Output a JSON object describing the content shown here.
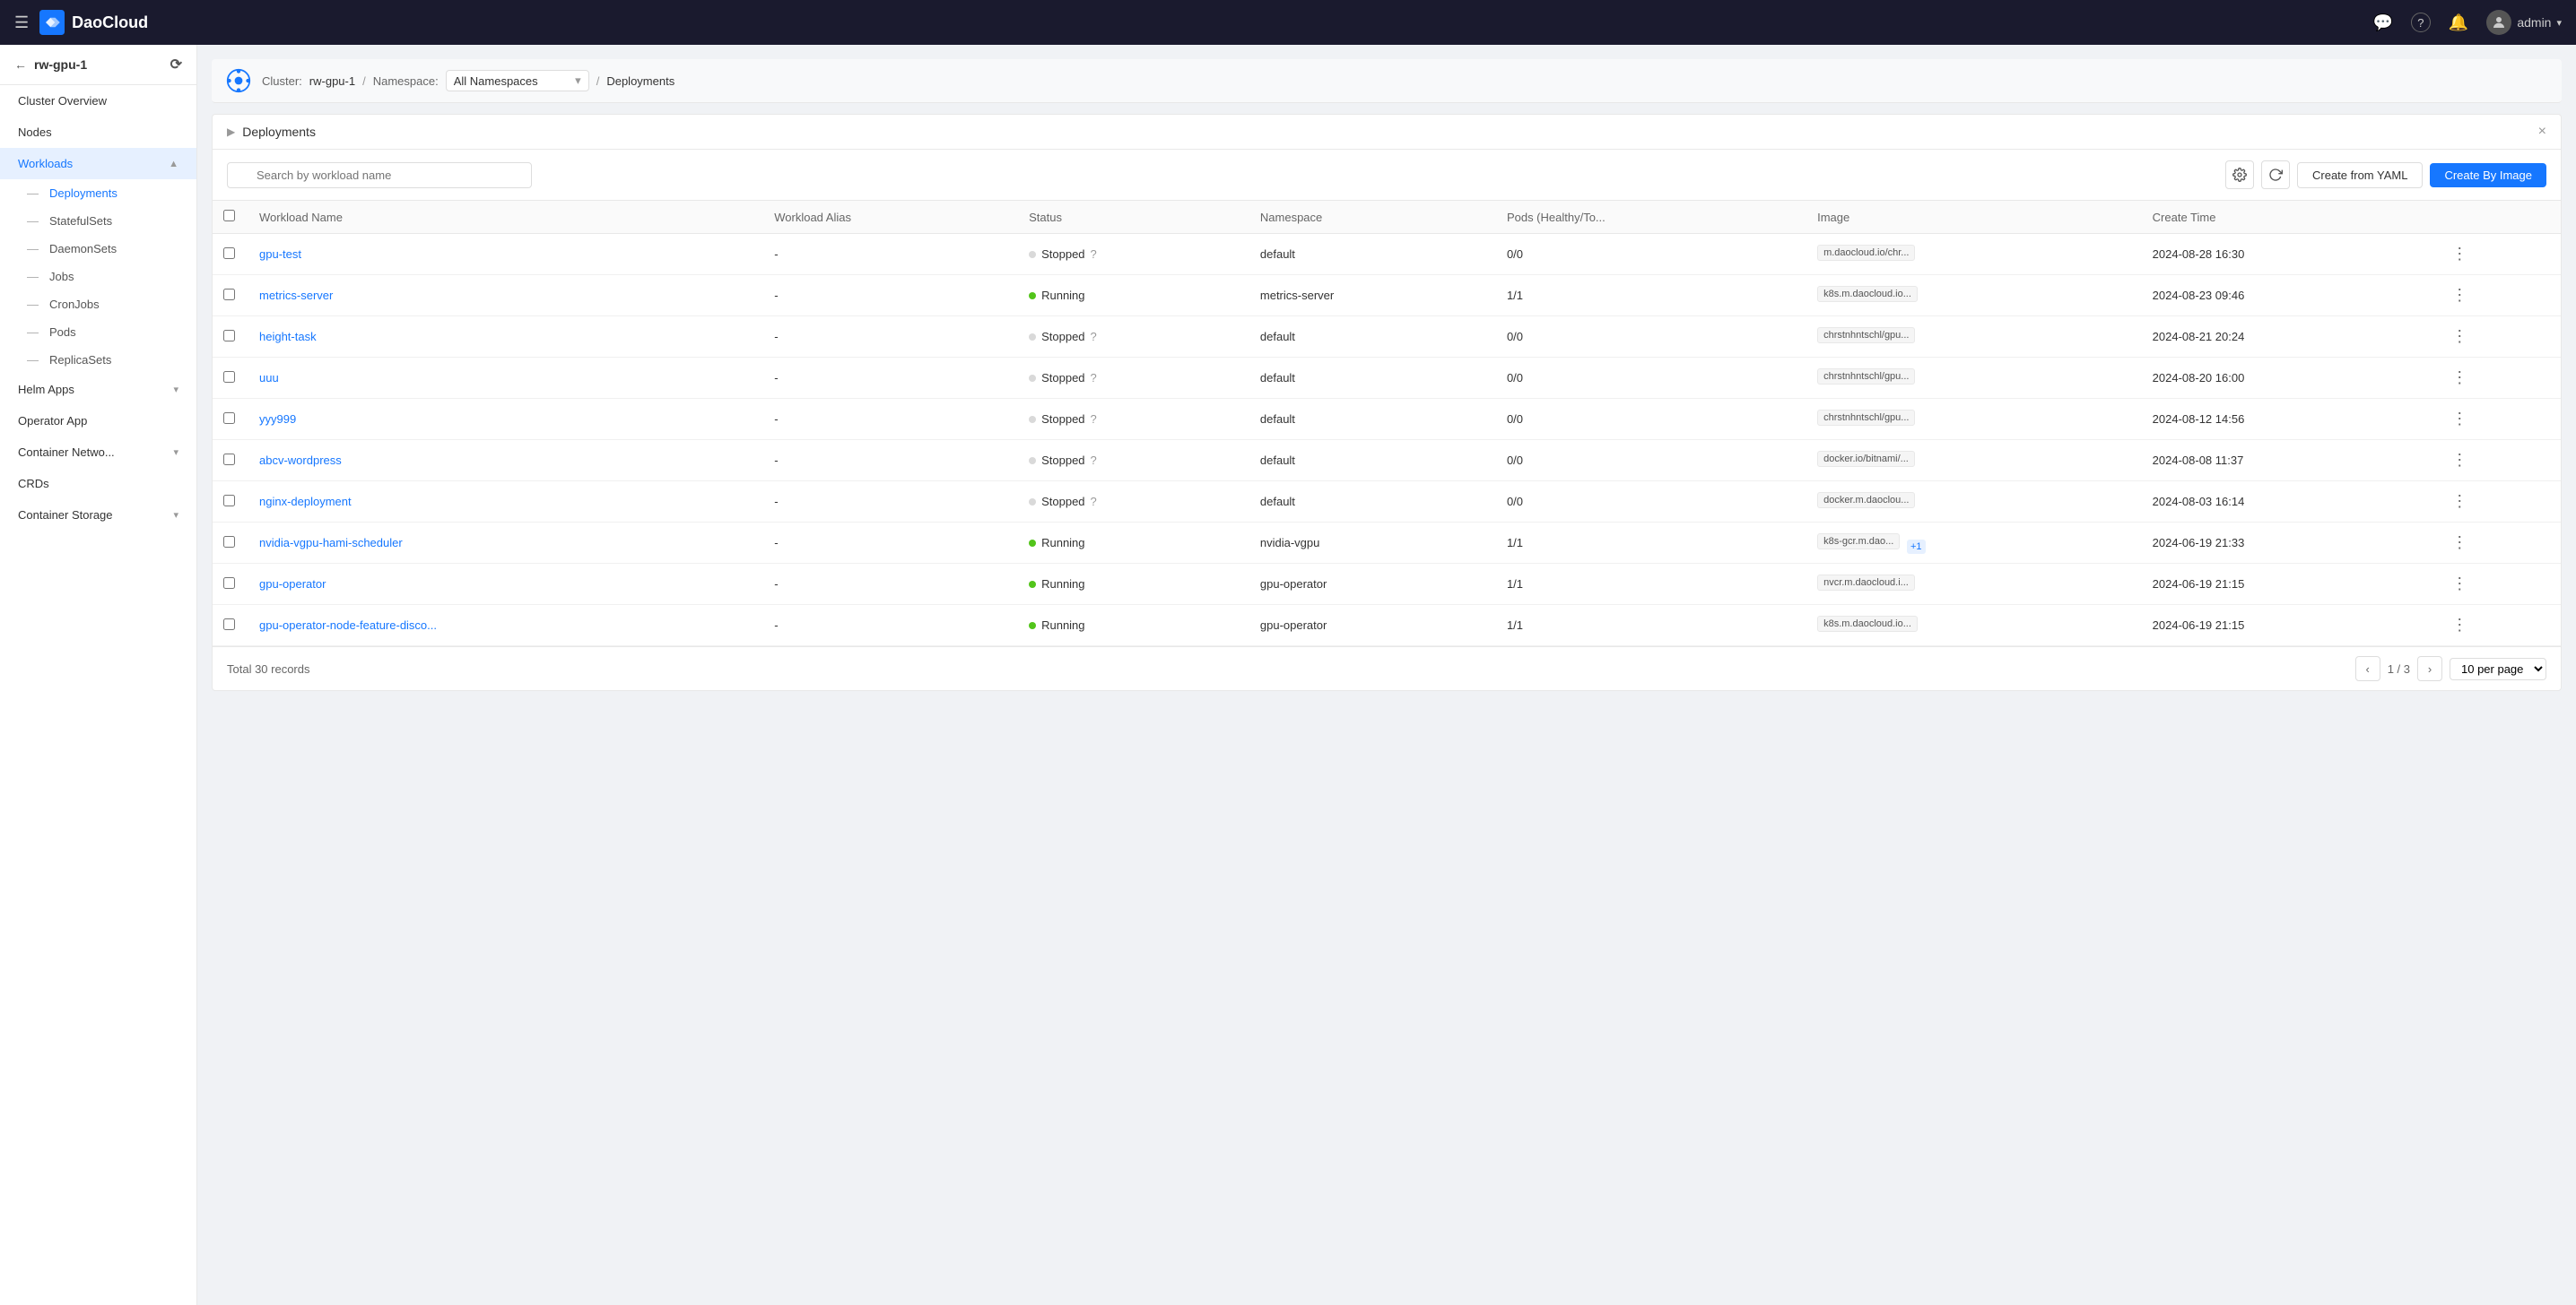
{
  "app": {
    "title": "DaoCloud"
  },
  "topnav": {
    "menu_icon": "☰",
    "logo_text": "DaoCloud",
    "user_name": "admin",
    "icons": {
      "chat": "💬",
      "help": "?",
      "bell": "🔔"
    }
  },
  "sidebar": {
    "cluster_name": "rw-gpu-1",
    "nav_items": [
      {
        "label": "Cluster Overview",
        "active": false,
        "has_children": false
      },
      {
        "label": "Nodes",
        "active": false,
        "has_children": false
      },
      {
        "label": "Workloads",
        "active": true,
        "has_children": true,
        "expanded": true
      },
      {
        "label": "Helm Apps",
        "active": false,
        "has_children": true,
        "expanded": false
      },
      {
        "label": "Operator App",
        "active": false,
        "has_children": false
      },
      {
        "label": "Container Netwo...",
        "active": false,
        "has_children": true,
        "expanded": false
      },
      {
        "label": "CRDs",
        "active": false,
        "has_children": false
      },
      {
        "label": "Container Storage",
        "active": false,
        "has_children": true,
        "expanded": false
      }
    ],
    "workload_sub_items": [
      {
        "label": "Deployments",
        "active": true
      },
      {
        "label": "StatefulSets",
        "active": false
      },
      {
        "label": "DaemonSets",
        "active": false
      },
      {
        "label": "Jobs",
        "active": false
      },
      {
        "label": "CronJobs",
        "active": false
      },
      {
        "label": "Pods",
        "active": false
      },
      {
        "label": "ReplicaSets",
        "active": false
      }
    ]
  },
  "breadcrumb": {
    "cluster_label": "Cluster:",
    "cluster_value": "rw-gpu-1",
    "namespace_label": "Namespace:",
    "namespace_value": "All Namespaces",
    "page": "Deployments"
  },
  "panel": {
    "title": "Deployments",
    "close_label": "×"
  },
  "toolbar": {
    "search_placeholder": "Search by workload name",
    "create_yaml_label": "Create from YAML",
    "create_image_label": "Create By Image"
  },
  "table": {
    "columns": [
      "Workload Name",
      "Workload Alias",
      "Status",
      "Namespace",
      "Pods (Healthy/To...",
      "Image",
      "Create Time",
      ""
    ],
    "rows": [
      {
        "name": "gpu-test",
        "alias": "-",
        "status": "Stopped",
        "status_type": "stopped",
        "namespace": "default",
        "pods": "0/0",
        "image": "m.daocloud.io/chr...",
        "create_time": "2024-08-28 16:30"
      },
      {
        "name": "metrics-server",
        "alias": "-",
        "status": "Running",
        "status_type": "running",
        "namespace": "metrics-server",
        "pods": "1/1",
        "image": "k8s.m.daocloud.io...",
        "create_time": "2024-08-23 09:46"
      },
      {
        "name": "height-task",
        "alias": "-",
        "status": "Stopped",
        "status_type": "stopped",
        "namespace": "default",
        "pods": "0/0",
        "image": "chrstnhntschl/gpu...",
        "create_time": "2024-08-21 20:24"
      },
      {
        "name": "uuu",
        "alias": "-",
        "status": "Stopped",
        "status_type": "stopped",
        "namespace": "default",
        "pods": "0/0",
        "image": "chrstnhntschl/gpu...",
        "create_time": "2024-08-20 16:00"
      },
      {
        "name": "yyy999",
        "alias": "-",
        "status": "Stopped",
        "status_type": "stopped",
        "namespace": "default",
        "pods": "0/0",
        "image": "chrstnhntschl/gpu...",
        "create_time": "2024-08-12 14:56"
      },
      {
        "name": "abcv-wordpress",
        "alias": "-",
        "status": "Stopped",
        "status_type": "stopped",
        "namespace": "default",
        "pods": "0/0",
        "image": "docker.io/bitnami/...",
        "create_time": "2024-08-08 11:37"
      },
      {
        "name": "nginx-deployment",
        "alias": "-",
        "status": "Stopped",
        "status_type": "stopped",
        "namespace": "default",
        "pods": "0/0",
        "image": "docker.m.daoclou...",
        "create_time": "2024-08-03 16:14"
      },
      {
        "name": "nvidia-vgpu-hami-scheduler",
        "alias": "-",
        "status": "Running",
        "status_type": "running",
        "namespace": "nvidia-vgpu",
        "pods": "1/1",
        "image": "k8s-gcr.m.dao...",
        "image_extra": "+1",
        "create_time": "2024-06-19 21:33"
      },
      {
        "name": "gpu-operator",
        "alias": "-",
        "status": "Running",
        "status_type": "running",
        "namespace": "gpu-operator",
        "pods": "1/1",
        "image": "nvcr.m.daocloud.i...",
        "create_time": "2024-06-19 21:15"
      },
      {
        "name": "gpu-operator-node-feature-disco...",
        "alias": "-",
        "status": "Running",
        "status_type": "running",
        "namespace": "gpu-operator",
        "pods": "1/1",
        "image": "k8s.m.daocloud.io...",
        "create_time": "2024-06-19 21:15"
      }
    ]
  },
  "footer": {
    "total_label": "Total 30 records",
    "page_info": "1 / 3",
    "per_page": "10 per page"
  }
}
